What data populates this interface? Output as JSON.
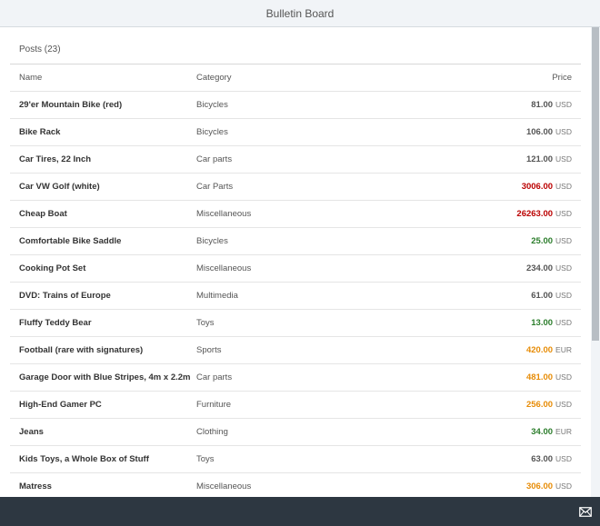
{
  "header": {
    "title": "Bulletin Board"
  },
  "posts": {
    "title": "Posts (23)",
    "columns": {
      "name": "Name",
      "category": "Category",
      "price": "Price"
    },
    "rows": [
      {
        "name": "29'er Mountain Bike (red)",
        "category": "Bicycles",
        "amount": "81.00",
        "currency": "USD",
        "status_color": "#555555"
      },
      {
        "name": "Bike Rack",
        "category": "Bicycles",
        "amount": "106.00",
        "currency": "USD",
        "status_color": "#555555"
      },
      {
        "name": "Car Tires, 22 Inch",
        "category": "Car parts",
        "amount": "121.00",
        "currency": "USD",
        "status_color": "#555555"
      },
      {
        "name": "Car VW Golf (white)",
        "category": "Car Parts",
        "amount": "3006.00",
        "currency": "USD",
        "status_color": "#bb0000"
      },
      {
        "name": "Cheap Boat",
        "category": "Miscellaneous",
        "amount": "26263.00",
        "currency": "USD",
        "status_color": "#bb0000"
      },
      {
        "name": "Comfortable Bike Saddle",
        "category": "Bicycles",
        "amount": "25.00",
        "currency": "USD",
        "status_color": "#2b7d2b"
      },
      {
        "name": "Cooking Pot Set",
        "category": "Miscellaneous",
        "amount": "234.00",
        "currency": "USD",
        "status_color": "#555555"
      },
      {
        "name": "DVD: Trains of Europe",
        "category": "Multimedia",
        "amount": "61.00",
        "currency": "USD",
        "status_color": "#555555"
      },
      {
        "name": "Fluffy Teddy Bear",
        "category": "Toys",
        "amount": "13.00",
        "currency": "USD",
        "status_color": "#2b7d2b"
      },
      {
        "name": "Football (rare with signatures)",
        "category": "Sports",
        "amount": "420.00",
        "currency": "EUR",
        "status_color": "#e78c07"
      },
      {
        "name": "Garage Door with Blue Stripes, 4m x 2.2m",
        "category": "Car parts",
        "amount": "481.00",
        "currency": "USD",
        "status_color": "#e78c07"
      },
      {
        "name": "High-End Gamer PC",
        "category": "Furniture",
        "amount": "256.00",
        "currency": "USD",
        "status_color": "#e78c07"
      },
      {
        "name": "Jeans",
        "category": "Clothing",
        "amount": "34.00",
        "currency": "EUR",
        "status_color": "#2b7d2b"
      },
      {
        "name": "Kids Toys, a Whole Box of Stuff",
        "category": "Toys",
        "amount": "63.00",
        "currency": "USD",
        "status_color": "#555555"
      },
      {
        "name": "Matress",
        "category": "Miscellaneous",
        "amount": "306.00",
        "currency": "USD",
        "status_color": "#e78c07"
      }
    ]
  },
  "footer": {
    "icon": "mail-icon"
  },
  "colors": {
    "header_bg": "#f1f4f7",
    "footer_bg": "#2d3741",
    "error": "#bb0000",
    "warning": "#e78c07",
    "success": "#2b7d2b"
  }
}
